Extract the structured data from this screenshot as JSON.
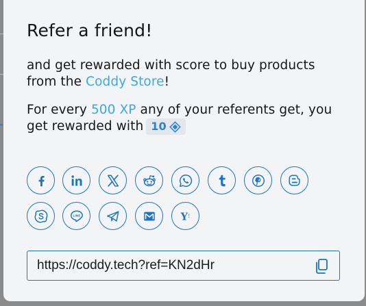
{
  "modal": {
    "title": "Refer a friend!",
    "intro_text": "and get rewarded with score to buy products from the ",
    "store_link": "Coddy Store",
    "intro_end": "!",
    "reward_prefix": "For every ",
    "xp_amount": "500 XP",
    "reward_middle": " any of your referents get, you get rewarded with",
    "reward_value": "10",
    "reward_icon": "diamond-icon"
  },
  "share_buttons": [
    {
      "id": "facebook",
      "icon": "facebook-icon"
    },
    {
      "id": "linkedin",
      "icon": "linkedin-icon"
    },
    {
      "id": "x",
      "icon": "x-icon"
    },
    {
      "id": "reddit",
      "icon": "reddit-icon"
    },
    {
      "id": "whatsapp",
      "icon": "whatsapp-icon"
    },
    {
      "id": "tumblr",
      "icon": "tumblr-icon"
    },
    {
      "id": "pinterest",
      "icon": "pinterest-icon"
    },
    {
      "id": "blogger",
      "icon": "blogger-icon"
    },
    {
      "id": "skype",
      "icon": "skype-icon"
    },
    {
      "id": "line",
      "icon": "line-icon"
    },
    {
      "id": "telegram",
      "icon": "telegram-icon"
    },
    {
      "id": "email",
      "icon": "email-icon"
    },
    {
      "id": "hackernews",
      "icon": "hackernews-icon"
    }
  ],
  "referral": {
    "url": "https://coddy.tech?ref=KN2dHr",
    "copy_icon": "copy-icon"
  },
  "colors": {
    "accent": "#1c74c4",
    "link": "#3aa8e8",
    "background": "#f3f4f6"
  }
}
